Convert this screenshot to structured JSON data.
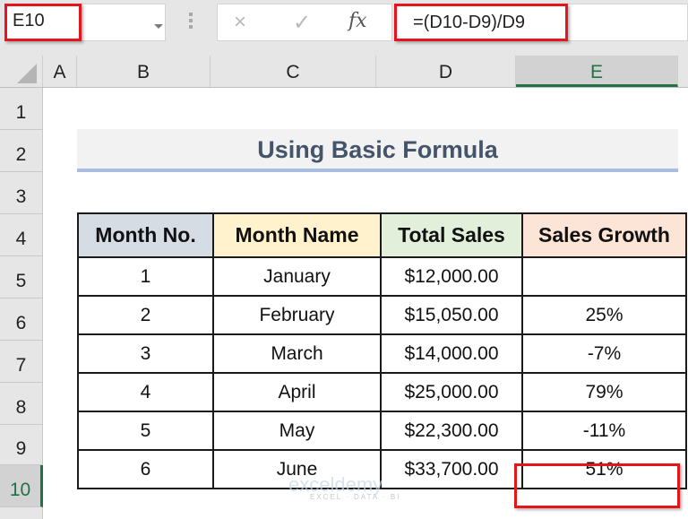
{
  "formula_bar": {
    "name_box": "E10",
    "cancel_icon": "×",
    "enter_icon": "✓",
    "fx_label": "fx",
    "formula": "=(D10-D9)/D9"
  },
  "columns": [
    "A",
    "B",
    "C",
    "D",
    "E"
  ],
  "selected_column": "E",
  "rows": [
    "1",
    "2",
    "3",
    "4",
    "5",
    "6",
    "7",
    "8",
    "9",
    "10"
  ],
  "selected_row": "10",
  "title": "Using Basic Formula",
  "table": {
    "headers": [
      "Month No.",
      "Month Name",
      "Total Sales",
      "Sales Growth"
    ],
    "rows": [
      [
        "1",
        "January",
        "$12,000.00",
        ""
      ],
      [
        "2",
        "February",
        "$15,050.00",
        "25%"
      ],
      [
        "3",
        "March",
        "$14,000.00",
        "-7%"
      ],
      [
        "4",
        "April",
        "$25,000.00",
        "79%"
      ],
      [
        "5",
        "May",
        "$22,300.00",
        "-11%"
      ],
      [
        "6",
        "June",
        "$33,700.00",
        "51%"
      ]
    ]
  },
  "watermark": {
    "name": "exceldemy",
    "tagline": "EXCEL · DATA · BI"
  },
  "colors": {
    "highlight": "#e8141c",
    "selection": "#217346",
    "title_text": "#44546a"
  }
}
